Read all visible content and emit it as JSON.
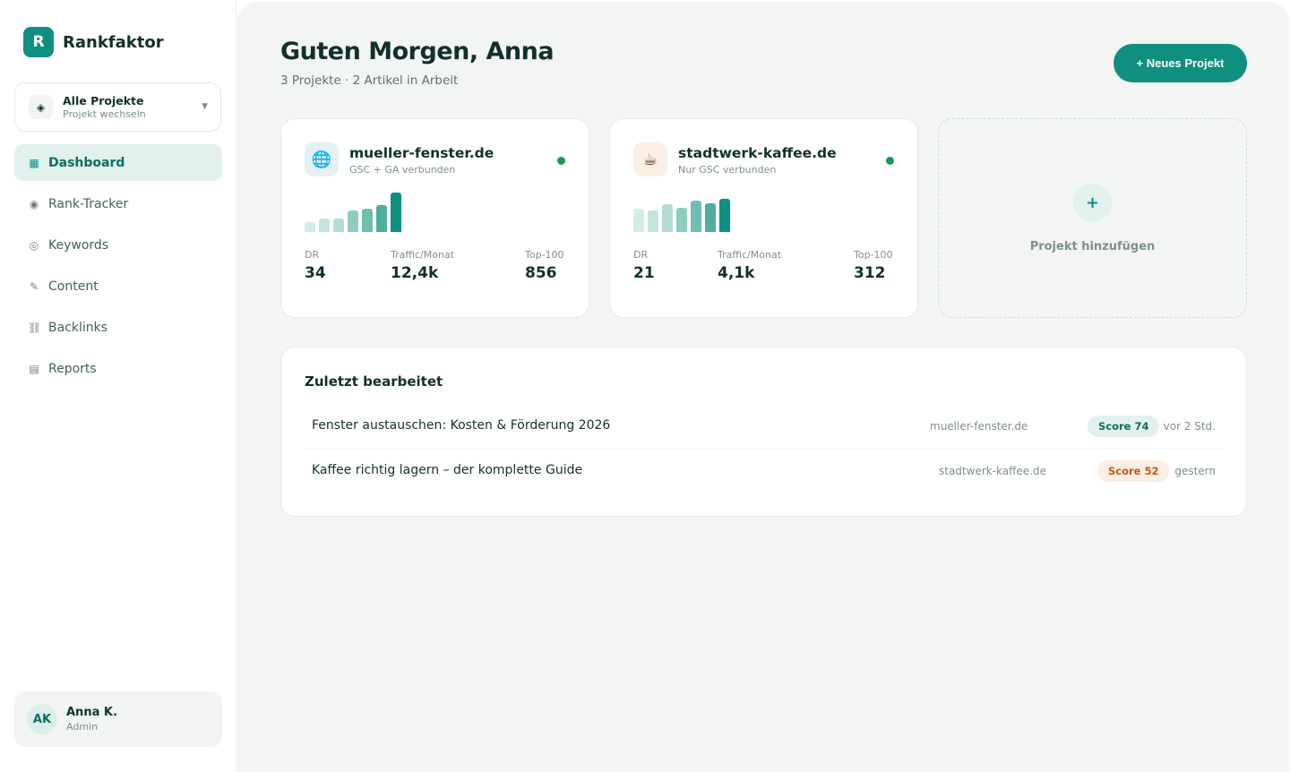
{
  "brand": {
    "logo_letter": "R",
    "name": "Rankfaktor"
  },
  "project_switcher": {
    "icon": "layers-icon",
    "title": "Alle Projekte",
    "subtitle": "Projekt wechseln"
  },
  "nav": [
    {
      "label": "Dashboard",
      "icon": "grid-icon",
      "active": true
    },
    {
      "label": "Rank-Tracker",
      "icon": "target-icon",
      "active": false
    },
    {
      "label": "Keywords",
      "icon": "circle-icon",
      "active": false
    },
    {
      "label": "Content",
      "icon": "pencil-icon",
      "active": false
    },
    {
      "label": "Backlinks",
      "icon": "link-icon",
      "active": false
    },
    {
      "label": "Reports",
      "icon": "report-icon",
      "active": false
    }
  ],
  "user": {
    "initials": "AK",
    "name": "Anna K.",
    "role": "Admin"
  },
  "header": {
    "greeting": "Guten Morgen, Anna",
    "subtitle": "3 Projekte · 2 Artikel in Arbeit",
    "new_project_label": "+ Neues Projekt"
  },
  "projects": [
    {
      "name": "mueller-fenster.de",
      "subtitle": "GSC + GA verbunden",
      "icon": "globe-icon",
      "status": "connected",
      "trend": [
        0.25,
        0.35,
        0.33,
        0.55,
        0.6,
        0.68,
        1.0
      ],
      "metrics": [
        {
          "label": "DR",
          "value": "34"
        },
        {
          "label": "Traffic/Monat",
          "value": "12,4k"
        },
        {
          "label": "Top-100",
          "value": "856"
        }
      ]
    },
    {
      "name": "stadtwerk-kaffee.de",
      "subtitle": "Nur GSC verbunden",
      "icon": "coffee-icon",
      "status": "connected",
      "trend": [
        0.6,
        0.55,
        0.7,
        0.62,
        0.8,
        0.72,
        0.85
      ],
      "metrics": [
        {
          "label": "DR",
          "value": "21"
        },
        {
          "label": "Traffic/Monat",
          "value": "4,1k"
        },
        {
          "label": "Top-100",
          "value": "312"
        }
      ]
    }
  ],
  "add_project": {
    "icon": "plus-icon",
    "label": "Projekt hinzufügen"
  },
  "recent": {
    "title": "Zuletzt bearbeitet",
    "items": [
      {
        "title": "Fenster austauschen: Kosten & Förderung 2026",
        "site": "mueller-fenster.de",
        "score": "Score 74",
        "time": "vor 2 Std."
      },
      {
        "title": "Kaffee richtig lagern – der komplette Guide",
        "site": "stadtwerk-kaffee.de",
        "score": "Score 52",
        "time": "gestern"
      }
    ]
  },
  "colors": {
    "accent": "#0f8f7f",
    "accent_light": "#e2f1ee",
    "status_green": "#159a4f",
    "score_mid": "#c0561a"
  }
}
